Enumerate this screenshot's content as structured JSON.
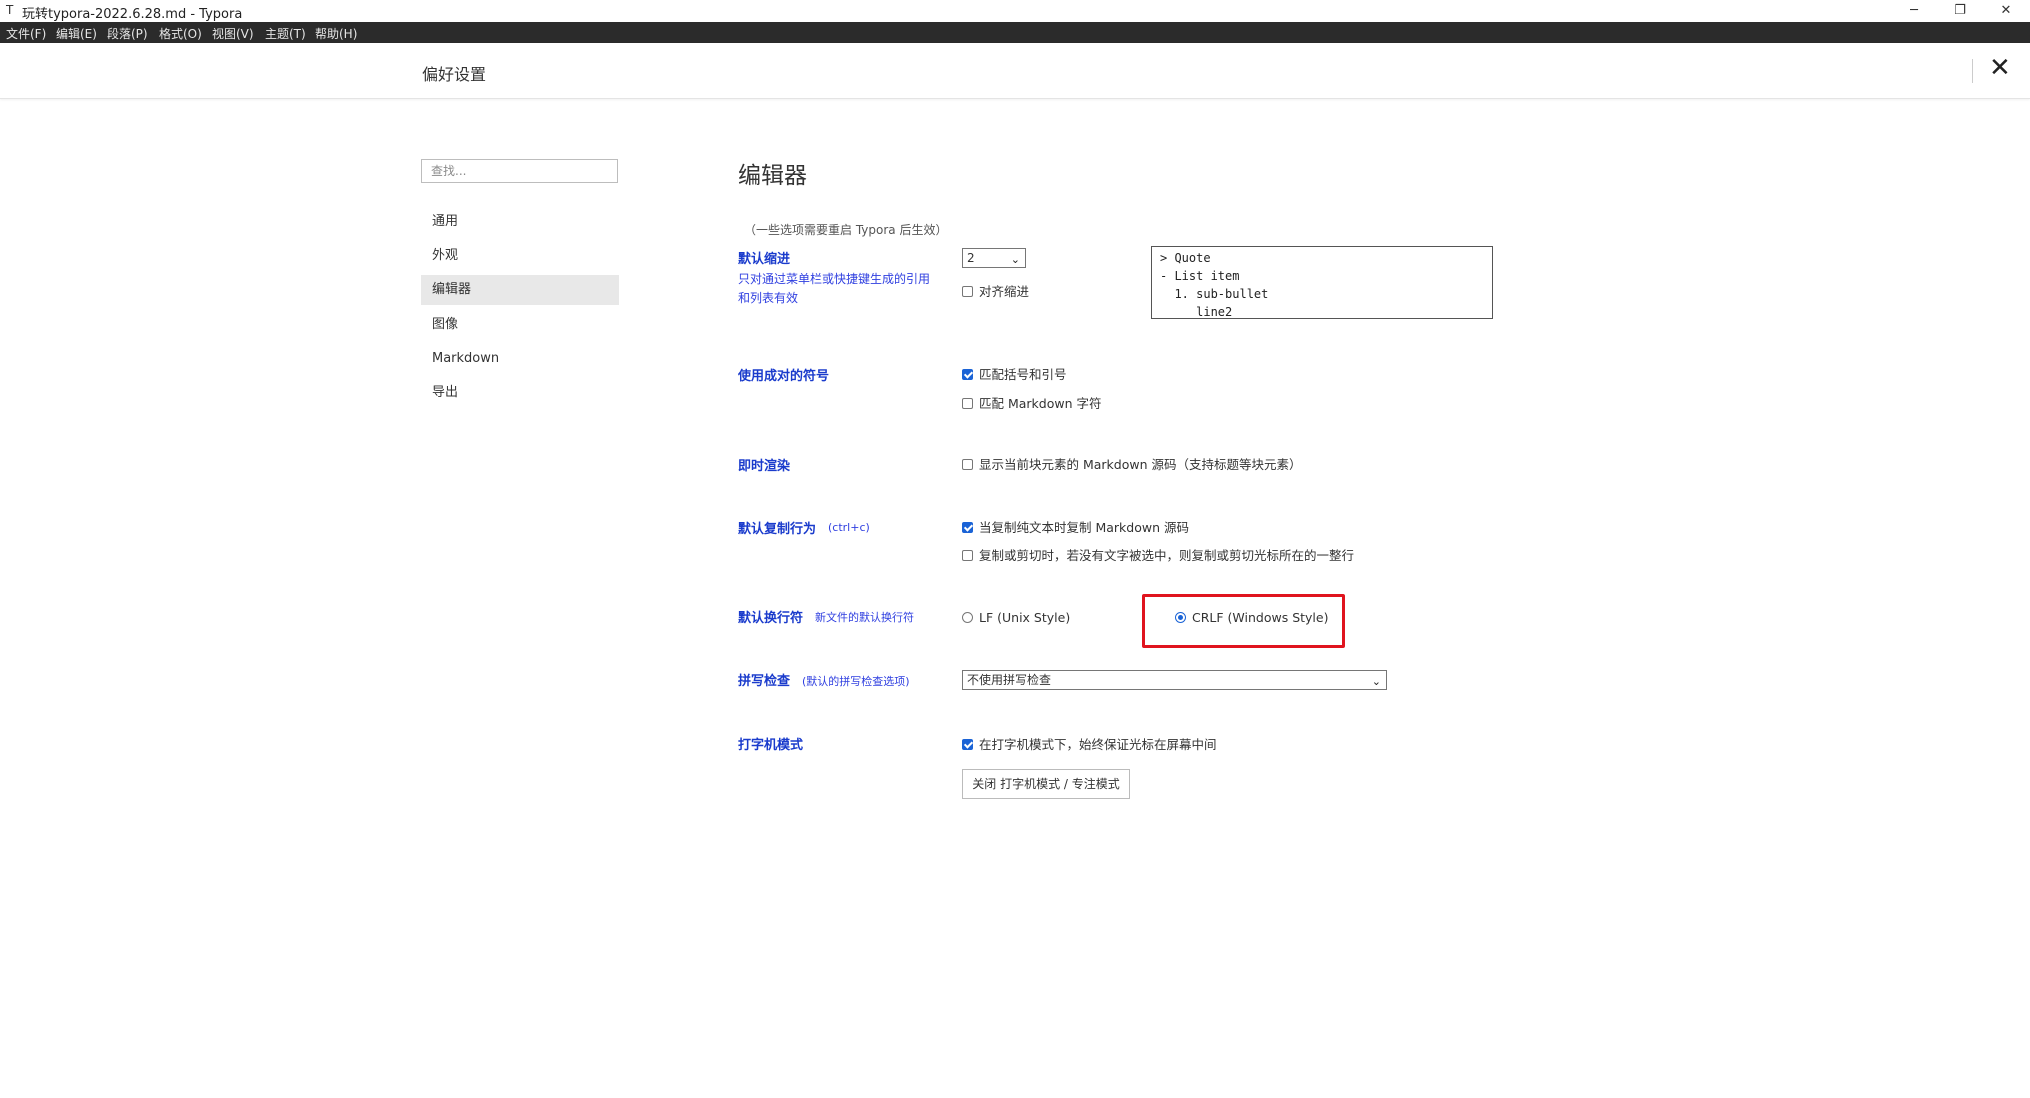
{
  "window": {
    "app_icon": "T",
    "title": "玩转typora-2022.6.28.md - Typora",
    "minimize": "─",
    "restore": "❐",
    "close": "✕"
  },
  "menu": [
    "文件(F)",
    "编辑(E)",
    "段落(P)",
    "格式(O)",
    "视图(V)",
    "主题(T)",
    "帮助(H)"
  ],
  "header": {
    "title": "偏好设置",
    "close": "✕"
  },
  "sidebar": {
    "search_placeholder": "查找...",
    "items": [
      {
        "label": "通用",
        "active": false
      },
      {
        "label": "外观",
        "active": false
      },
      {
        "label": "编辑器",
        "active": true
      },
      {
        "label": "图像",
        "active": false
      },
      {
        "label": "Markdown",
        "active": false
      },
      {
        "label": "导出",
        "active": false
      }
    ]
  },
  "main": {
    "title": "编辑器",
    "note": "（一些选项需要重启 Typora 后生效）",
    "indent": {
      "label": "默认缩进",
      "desc": "只对通过菜单栏或快捷键生成的引用和列表有效",
      "value": "2",
      "align_label": "对齐缩进",
      "align_checked": false,
      "preview": [
        "> Quote",
        "- List item",
        "  1. sub-bullet",
        "     line2"
      ]
    },
    "pairs": {
      "label": "使用成对的符号",
      "opt1": "匹配括号和引号",
      "opt1_checked": true,
      "opt2": "匹配 Markdown 字符",
      "opt2_checked": false
    },
    "live": {
      "label": "即时渲染",
      "opt1": "显示当前块元素的 Markdown 源码（支持标题等块元素）",
      "opt1_checked": false
    },
    "copy": {
      "label": "默认复制行为",
      "sublabel": "(ctrl+c)",
      "opt1": "当复制纯文本时复制 Markdown 源码",
      "opt1_checked": true,
      "opt2": "复制或剪切时，若没有文字被选中，则复制或剪切光标所在的一整行",
      "opt2_checked": false
    },
    "linebreak": {
      "label": "默认换行符",
      "sublabel": "新文件的默认换行符",
      "lf": "LF (Unix Style)",
      "lf_checked": false,
      "crlf": "CRLF (Windows Style)",
      "crlf_checked": true,
      "highlight_color": "#e0141e"
    },
    "spell": {
      "label": "拼写检查",
      "sublabel": "(默认的拼写检查选项)",
      "value": "不使用拼写检查"
    },
    "typewriter": {
      "label": "打字机模式",
      "opt1": "在打字机模式下，始终保证光标在屏幕中间",
      "opt1_checked": true,
      "button": "关闭 打字机模式 / 专注模式"
    }
  },
  "colors": {
    "accent_label": "#1a3bcc",
    "menubar_bg": "#2b2b2b",
    "checkbox": "#1a63d6"
  }
}
